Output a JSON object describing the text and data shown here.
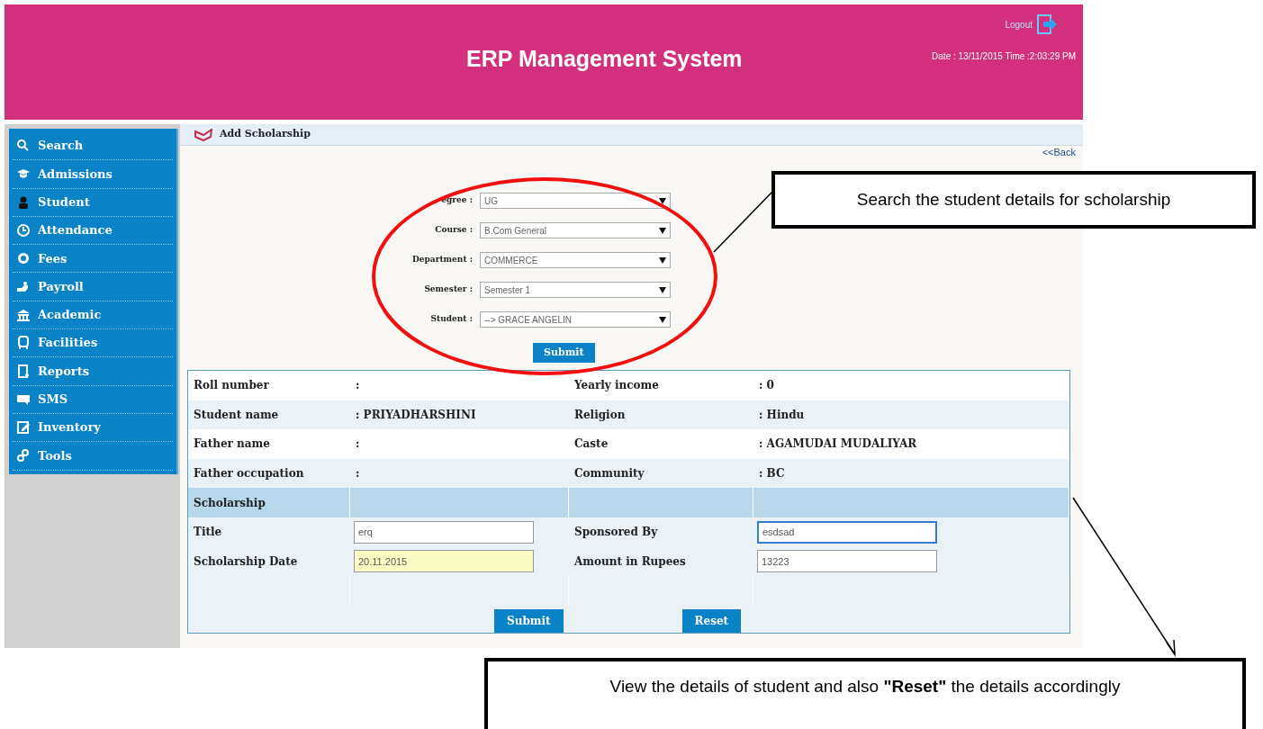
{
  "header": {
    "title": "ERP Management System",
    "logout": "Logout",
    "datetime": "Date : 13/11/2015 Time :2:03:29 PM"
  },
  "sidebar": {
    "items": [
      "Search",
      "Admissions",
      "Student",
      "Attendance",
      "Fees",
      "Payroll",
      "Academic",
      "Facilities",
      "Reports",
      "SMS",
      "Inventory",
      "Tools"
    ]
  },
  "page": {
    "title": "Add Scholarship",
    "back": "<<Back"
  },
  "filters": [
    {
      "label": "egree :",
      "value": "UG"
    },
    {
      "label": "Course :",
      "value": "B.Com General"
    },
    {
      "label": "Department :",
      "value": "COMMERCE"
    },
    {
      "label": "Semester :",
      "value": "Semester 1"
    },
    {
      "label": "Student :",
      "value": "--> GRACE ANGELIN"
    }
  ],
  "filter_submit": "Submit",
  "details": [
    {
      "label": "Roll number",
      "value": ":",
      "label2": "Yearly income",
      "value2": ": 0"
    },
    {
      "label": "Student name",
      "value": ": PRIYADHARSHINI",
      "label2": "Religion",
      "value2": ": Hindu"
    },
    {
      "label": "Father name",
      "value": ":",
      "label2": "Caste",
      "value2": ": AGAMUDAI MUDALIYAR"
    },
    {
      "label": "Father occupation",
      "value": ":",
      "label2": "Community",
      "value2": ": BC"
    }
  ],
  "section": "Scholarship",
  "fields": [
    {
      "label": "Title",
      "value": "erq",
      "kind": "text"
    },
    {
      "label": "Sponsored By",
      "value": "esdsad",
      "kind": "focused"
    },
    {
      "label": "Scholarship Date",
      "value": "20.11.2015",
      "kind": "date"
    },
    {
      "label": "Amount in Rupees",
      "value": "13223",
      "kind": "text"
    }
  ],
  "buttons": [
    "Submit",
    "Reset"
  ],
  "callouts": [
    "Search the student details for scholarship",
    "View the details of student and also **\"Reset\"** the details accordingly"
  ]
}
